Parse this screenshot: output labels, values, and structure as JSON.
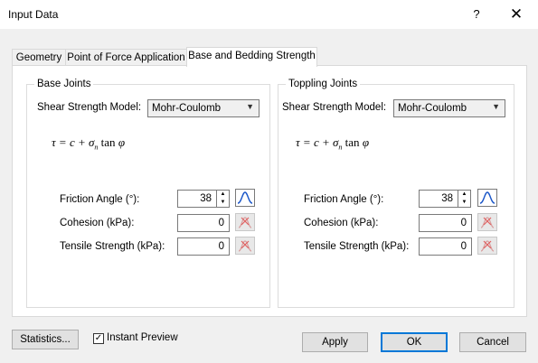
{
  "window": {
    "title": "Input Data",
    "help_glyph": "?",
    "close_glyph": "✕"
  },
  "tabs": [
    {
      "label": "Geometry",
      "active": false
    },
    {
      "label": "Point of Force Application",
      "active": false
    },
    {
      "label": "Base and Bedding Strength",
      "active": true
    }
  ],
  "base_joints": {
    "title": "Base Joints",
    "model_label": "Shear Strength Model:",
    "model_value": "Mohr-Coulomb",
    "formula": "τ = c + σn tan φ",
    "friction_label": "Friction Angle (°):",
    "friction_value": "38",
    "cohesion_label": "Cohesion (kPa):",
    "cohesion_value": "0",
    "tensile_label": "Tensile Strength (kPa):",
    "tensile_value": "0"
  },
  "toppling_joints": {
    "title": "Toppling Joints",
    "model_label": "Shear Strength Model:",
    "model_value": "Mohr-Coulomb",
    "formula": "τ = c + σn tan φ",
    "friction_label": "Friction Angle (°):",
    "friction_value": "38",
    "cohesion_label": "Cohesion (kPa):",
    "cohesion_value": "0",
    "tensile_label": "Tensile Strength (kPa):",
    "tensile_value": "0"
  },
  "footer": {
    "statistics": "Statistics...",
    "instant_preview": "Instant Preview",
    "instant_preview_checked": true,
    "apply": "Apply",
    "ok": "OK",
    "cancel": "Cancel"
  },
  "colors": {
    "accent": "#0078d7",
    "dist_curve": "#1a56c8",
    "dist_disabled": "#e06060"
  }
}
